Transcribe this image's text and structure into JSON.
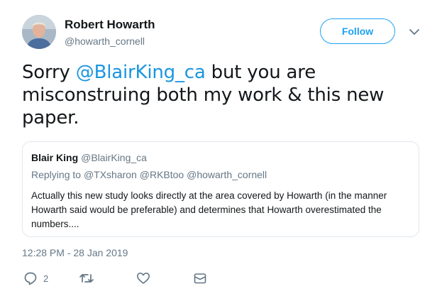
{
  "author": {
    "name": "Robert Howarth",
    "handle": "@howarth_cornell"
  },
  "follow_label": "Follow",
  "tweet": {
    "text_before": "Sorry ",
    "mention": "@BlairKing_ca",
    "text_after": " but you are misconstruing both my work & this new paper."
  },
  "quote": {
    "name": "Blair King",
    "handle": "@BlairKing_ca",
    "replying_label": "Replying to",
    "replying_to": [
      "@TXsharon",
      "@RKBtoo",
      "@howarth_cornell"
    ],
    "body": "Actually this new study looks directly at the area covered by Howarth (in the manner Howarth said would be preferable) and determines that Howarth overestimated the numbers...."
  },
  "timestamp": "12:28 PM - 28 Jan 2019",
  "actions": {
    "reply_count": "2",
    "icons": [
      "reply-icon",
      "retweet-icon",
      "like-icon",
      "message-icon"
    ]
  },
  "colors": {
    "accent": "#1da1f2",
    "link": "#1b95e0",
    "secondary_text": "#657786",
    "border": "#e1e8ed"
  }
}
